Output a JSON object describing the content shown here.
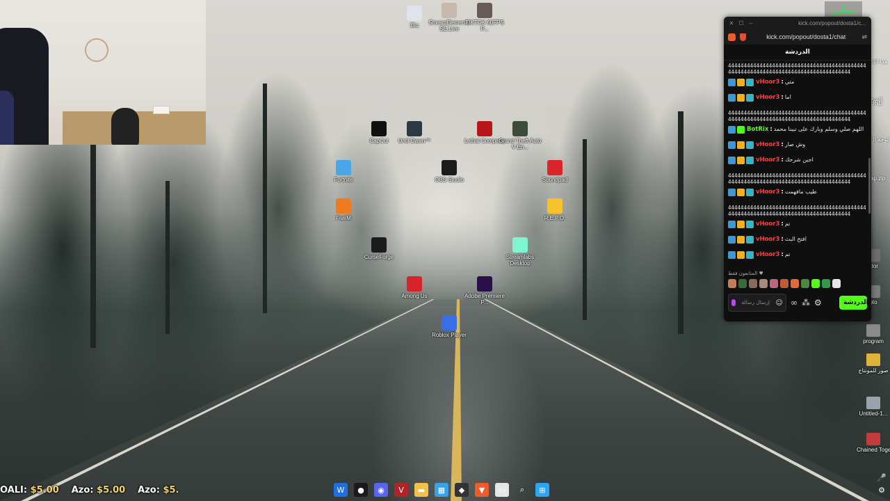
{
  "desktop_icons": [
    {
      "label": "Blu",
      "color": "#dfe3ea"
    },
    {
      "label": "StreamElements SE.Live",
      "color": "#c8b9ac"
    },
    {
      "label": "TIKTOK 60FPS P...",
      "color": "#6a5a56"
    },
    {
      "label": "CapCut",
      "color": "#111111"
    },
    {
      "label": "Until Dawn™",
      "color": "#2c3a46"
    },
    {
      "label": "Lethal Company",
      "color": "#b8161a"
    },
    {
      "label": "Grand Theft Auto V En...",
      "color": "#3b4d3a"
    },
    {
      "label": "Fortnite",
      "color": "#47a7e8"
    },
    {
      "label": "OBS Studio",
      "color": "#1c1c1c"
    },
    {
      "label": "Soundpad",
      "color": "#d8262b"
    },
    {
      "label": "FiveM",
      "color": "#f07b1e"
    },
    {
      "label": "R.E.P.O.",
      "color": "#f6c12b"
    },
    {
      "label": "CurseForge",
      "color": "#1b1b1b"
    },
    {
      "label": "Streamlabs Desktop",
      "color": "#80f5d2"
    },
    {
      "label": "Among Us",
      "color": "#d8232a"
    },
    {
      "label": "Adobe Premiere P...",
      "color": "#2a0f4a"
    },
    {
      "label": "Roblox Player",
      "color": "#3a6ee8"
    }
  ],
  "right_icons": [
    {
      "label": "ator"
    },
    {
      "label": "oto"
    },
    {
      "label": "program"
    },
    {
      "label": "صور للمونتاج"
    },
    {
      "label": "Untitled-1..."
    },
    {
      "label": "Chained Together"
    }
  ],
  "right_edge_labels": [
    "هذا الك",
    "الشخ",
    "لوحة ال",
    "ap.zip",
    "UND"
  ],
  "corner_tag": "صلي واجي",
  "corner_green": "K",
  "chat": {
    "titlebar_text": "kick.com/popout/dosta1/c...",
    "url": "kick.com/popout/dosta1/chat",
    "header": "الدردشة",
    "messages": [
      {
        "type": "spam",
        "text": "44444444444444444444444444444444444444444444444444444444444444444444444444444444444"
      },
      {
        "type": "msg",
        "user": "vHoor3",
        "color": "#ff3d3d",
        "badges": [
          "kick",
          "crown",
          "sub"
        ],
        "text": "متي"
      },
      {
        "type": "msg",
        "user": "vHoor3",
        "color": "#ff3d3d",
        "badges": [
          "kick",
          "crown",
          "sub"
        ],
        "text": "اما"
      },
      {
        "type": "spam",
        "text": "44444444444444444444444444444444444444444444444444444444444444444444444444444444444"
      },
      {
        "type": "msg",
        "user": "BotRix",
        "color": "#53fc18",
        "badges": [
          "kick",
          "bot"
        ],
        "text": "اللهم صلي وسلم وبارك على نبينا محمد"
      },
      {
        "type": "msg",
        "user": "vHoor3",
        "color": "#ff3d3d",
        "badges": [
          "kick",
          "crown",
          "sub"
        ],
        "text": "وش صار"
      },
      {
        "type": "msg",
        "user": "vHoor3",
        "color": "#ff3d3d",
        "badges": [
          "kick",
          "crown",
          "sub"
        ],
        "text": "اجين شرحك"
      },
      {
        "type": "spam",
        "text": "44444444444444444444444444444444444444444444444444444444444444444444444444444444444"
      },
      {
        "type": "msg",
        "user": "vHoor3",
        "color": "#ff3d3d",
        "badges": [
          "kick",
          "crown",
          "sub"
        ],
        "text": "طيب مافهمت"
      },
      {
        "type": "spam",
        "text": "44444444444444444444444444444444444444444444444444444444444444444444444444444444444"
      },
      {
        "type": "msg",
        "user": "vHoor3",
        "color": "#ff3d3d",
        "badges": [
          "kick",
          "crown",
          "sub"
        ],
        "text": "تم"
      },
      {
        "type": "msg",
        "user": "vHoor3",
        "color": "#ff3d3d",
        "badges": [
          "kick",
          "crown",
          "sub"
        ],
        "text": "افتح البث"
      },
      {
        "type": "msg",
        "user": "vHoor3",
        "color": "#ff3d3d",
        "badges": [
          "kick",
          "crown",
          "sub"
        ],
        "text": "تم"
      }
    ],
    "followers_label": "المتابعون فقط",
    "avatar_colors": [
      "#c97a5a",
      "#3a6b3a",
      "#8a6a5a",
      "#a78a7a",
      "#b86a7a",
      "#c05a3a",
      "#e06a3a",
      "#4a8a3a",
      "#53fc18",
      "#2e9a4a",
      "#e8e8e8"
    ],
    "input_placeholder": "إرسال رسالة",
    "send_label": "الدردشة"
  },
  "ticker": [
    {
      "name": "OALI",
      "amount": "$5.00"
    },
    {
      "name": "Azo",
      "amount": "$5.00"
    },
    {
      "name": "Azo",
      "amount": "$5."
    }
  ],
  "taskbar_icons": [
    {
      "name": "app-blue-icon",
      "color": "#1f6fe0",
      "glyph": "W"
    },
    {
      "name": "obs-icon",
      "color": "#1a1a1a",
      "glyph": "●"
    },
    {
      "name": "discord-icon",
      "color": "#5865f2",
      "glyph": "◉"
    },
    {
      "name": "voicemeeter-icon",
      "color": "#b0232a",
      "glyph": "V"
    },
    {
      "name": "file-explorer-icon",
      "color": "#f2c14b",
      "glyph": "▬"
    },
    {
      "name": "store-icon",
      "color": "#3aa0e8",
      "glyph": "▦"
    },
    {
      "name": "app-dark-icon",
      "color": "#333333",
      "glyph": "◆"
    },
    {
      "name": "brave-icon",
      "color": "#ef5b2a",
      "glyph": "▼"
    },
    {
      "name": "notepad-icon",
      "color": "#e6e6e6",
      "glyph": "▭"
    },
    {
      "name": "search-icon",
      "color": "transparent",
      "glyph": "⌕"
    },
    {
      "name": "windows-start-icon",
      "color": "#2ea4f5",
      "glyph": "⊞"
    }
  ],
  "tray": {
    "mic": "🎤",
    "settings": "⚙"
  }
}
